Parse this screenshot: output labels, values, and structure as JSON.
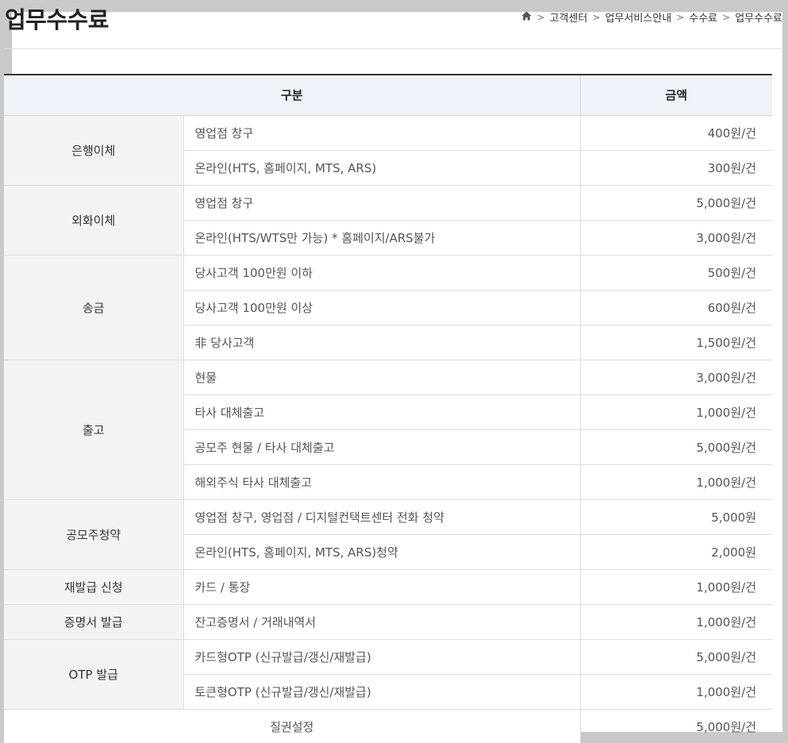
{
  "page": {
    "title": "업무수수료"
  },
  "breadcrumb": {
    "home_icon": "home-icon",
    "items": [
      "고객센터",
      "업무서비스안내",
      "수수료",
      "업무수수료"
    ],
    "separator": ">"
  },
  "table": {
    "headers": {
      "category": "구분",
      "amount": "금액"
    },
    "groups": [
      {
        "category": "은행이체",
        "rows": [
          {
            "item": "영업점 창구",
            "amount": "400원/건"
          },
          {
            "item": "온라인(HTS, 홈페이지, MTS, ARS)",
            "amount": "300원/건"
          }
        ]
      },
      {
        "category": "외화이체",
        "rows": [
          {
            "item": "영업점 창구",
            "amount": "5,000원/건"
          },
          {
            "item": "온라인(HTS/WTS만 가능) * 홈페이지/ARS불가",
            "amount": "3,000원/건"
          }
        ]
      },
      {
        "category": "송금",
        "rows": [
          {
            "item": "당사고객 100만원 이하",
            "amount": "500원/건"
          },
          {
            "item": "당사고객 100만원 이상",
            "amount": "600원/건"
          },
          {
            "item": "非 당사고객",
            "amount": "1,500원/건"
          }
        ]
      },
      {
        "category": "출고",
        "rows": [
          {
            "item": "현물",
            "amount": "3,000원/건"
          },
          {
            "item": "타사 대체출고",
            "amount": "1,000원/건"
          },
          {
            "item": "공모주 현물 / 타사 대체출고",
            "amount": "5,000원/건"
          },
          {
            "item": "해외주식 타사 대체출고",
            "amount": "1,000원/건"
          }
        ]
      },
      {
        "category": "공모주청약",
        "rows": [
          {
            "item": "영업점 창구, 영업점 / 디지털컨택트센터 전화 청약",
            "amount": "5,000원"
          },
          {
            "item": "온라인(HTS, 홈페이지, MTS, ARS)청약",
            "amount": "2,000원"
          }
        ]
      },
      {
        "category": "재발급 신청",
        "rows": [
          {
            "item": "카드 / 통장",
            "amount": "1,000원/건"
          }
        ]
      },
      {
        "category": "증명서 발급",
        "rows": [
          {
            "item": "잔고증명서 / 거래내역서",
            "amount": "1,000원/건"
          }
        ]
      },
      {
        "category": "OTP 발급",
        "rows": [
          {
            "item": "카드형OTP (신규발급/갱신/재발급)",
            "amount": "5,000원/건"
          },
          {
            "item": "토큰형OTP (신규발급/갱신/재발급)",
            "amount": "1,000원/건"
          }
        ]
      }
    ],
    "full_rows": [
      {
        "item": "질권설정",
        "amount": "5,000원/건"
      }
    ]
  }
}
